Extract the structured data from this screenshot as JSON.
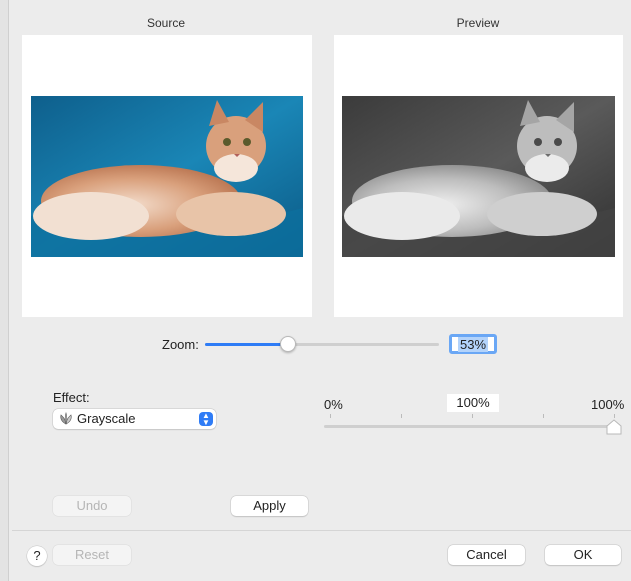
{
  "panels": {
    "source_title": "Source",
    "preview_title": "Preview"
  },
  "zoom": {
    "label": "Zoom:",
    "value_text": "53%",
    "slider_level": 0.35
  },
  "effect": {
    "label": "Effect:",
    "selected": "Grayscale",
    "icon": "grayscale-effect-icon"
  },
  "intensity": {
    "min_label": "0%",
    "value_text": "100%",
    "max_label": "100%",
    "level": 1.0
  },
  "buttons": {
    "undo": "Undo",
    "apply": "Apply",
    "reset": "Reset",
    "cancel": "Cancel",
    "ok": "OK",
    "help": "?"
  },
  "colors": {
    "accent": "#2e7cf6",
    "focus_ring": "#6aa7f5",
    "source_background": "#1a7aa8",
    "cat_fur": "#d9a380"
  }
}
